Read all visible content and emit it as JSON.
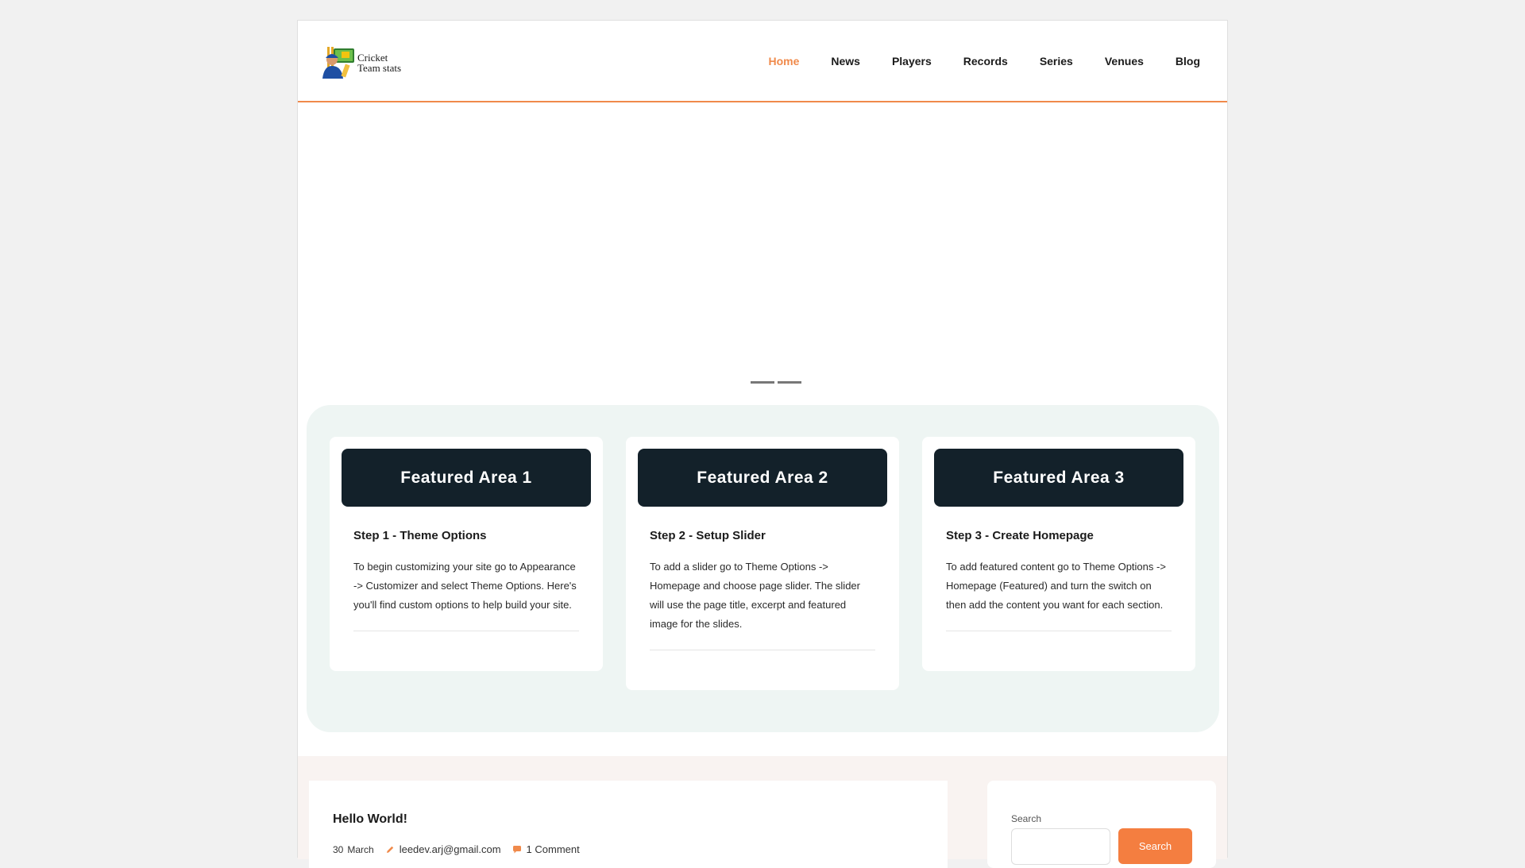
{
  "brand": {
    "line1": "Cricket",
    "line2": "Team stats"
  },
  "nav": {
    "items": [
      {
        "label": "Home",
        "active": true
      },
      {
        "label": "News"
      },
      {
        "label": "Players"
      },
      {
        "label": "Records"
      },
      {
        "label": "Series"
      },
      {
        "label": "Venues"
      },
      {
        "label": "Blog"
      }
    ]
  },
  "colors": {
    "accent": "#f08a4b",
    "button": "#f47e40",
    "banner": "#13212a",
    "featured_bg": "#eef5f3"
  },
  "featured": {
    "cards": [
      {
        "banner": "Featured Area 1",
        "title": "Step 1 - Theme Options",
        "text": "To begin customizing your site go to Appearance -> Customizer and select Theme Options. Here's you'll find custom options to help build your site."
      },
      {
        "banner": "Featured Area 2",
        "title": "Step 2 - Setup Slider",
        "text": "To add a slider go to Theme Options -> Homepage and choose page slider. The slider will use the page title, excerpt and featured image for the slides."
      },
      {
        "banner": "Featured Area 3",
        "title": "Step 3 - Create Homepage",
        "text": "To add featured content go to Theme Options -> Homepage (Featured) and turn the switch on then add the content you want for each section."
      }
    ]
  },
  "post": {
    "title": "Hello World!",
    "date_day": "30",
    "date_month": "March",
    "author": "leedev.arj@gmail.com",
    "comments": "1 Comment"
  },
  "search": {
    "label": "Search",
    "button": "Search",
    "placeholder": ""
  },
  "icons": {
    "author": "pencil-icon",
    "comments": "speech-bubble-icon"
  }
}
